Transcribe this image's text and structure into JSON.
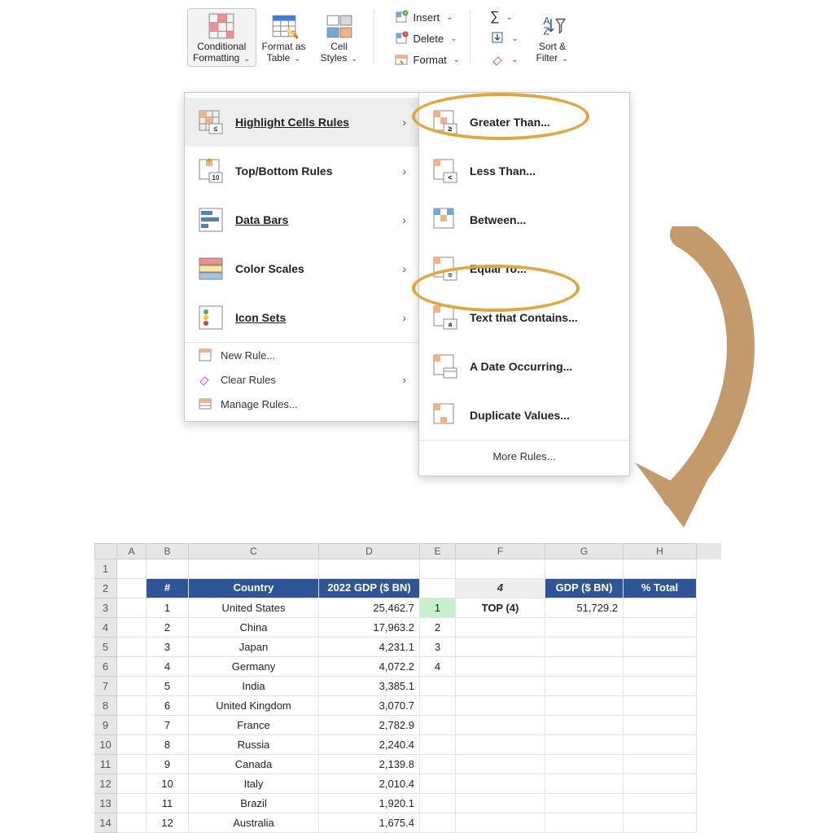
{
  "ribbon": {
    "cond": {
      "l1": "Conditional",
      "l2": "Formatting"
    },
    "fmtTable": {
      "l1": "Format as",
      "l2": "Table"
    },
    "cellStyles": {
      "l1": "Cell",
      "l2": "Styles"
    },
    "insert": "Insert",
    "delete": "Delete",
    "format": "Format",
    "sortFilter": {
      "l1": "Sort &",
      "l2": "Filter"
    }
  },
  "menu1": {
    "items": [
      {
        "label": "Highlight Cells Rules"
      },
      {
        "label": "Top/Bottom Rules"
      },
      {
        "label": "Data Bars"
      },
      {
        "label": "Color Scales"
      },
      {
        "label": "Icon Sets"
      }
    ],
    "sub": [
      {
        "label": "New Rule..."
      },
      {
        "label": "Clear Rules"
      },
      {
        "label": "Manage Rules..."
      }
    ]
  },
  "menu2": {
    "items": [
      {
        "label": "Greater Than..."
      },
      {
        "label": "Less Than..."
      },
      {
        "label": "Between..."
      },
      {
        "label": "Equal To..."
      },
      {
        "label": "Text that Contains..."
      },
      {
        "label": "A Date Occurring..."
      },
      {
        "label": "Duplicate Values..."
      }
    ],
    "more": "More Rules..."
  },
  "sheet": {
    "cols": [
      "",
      "A",
      "B",
      "C",
      "D",
      "E",
      "F",
      "G",
      "H"
    ],
    "header": {
      "num": "#",
      "country": "Country",
      "gdp": "2022 GDP ($ BN)",
      "fval": "4",
      "gbn": "GDP ($ BN)",
      "pct": "% Total"
    },
    "side": {
      "top": "TOP (4)",
      "gdpSum": "51,729.2"
    },
    "e": [
      "1",
      "2",
      "3",
      "4"
    ],
    "rows": [
      {
        "r": "1"
      },
      {
        "r": "2",
        "n": "#"
      },
      {
        "r": "3",
        "n": "1",
        "c": "United States",
        "g": "25,462.7"
      },
      {
        "r": "4",
        "n": "2",
        "c": "China",
        "g": "17,963.2"
      },
      {
        "r": "5",
        "n": "3",
        "c": "Japan",
        "g": "4,231.1"
      },
      {
        "r": "6",
        "n": "4",
        "c": "Germany",
        "g": "4,072.2"
      },
      {
        "r": "7",
        "n": "5",
        "c": "India",
        "g": "3,385.1"
      },
      {
        "r": "8",
        "n": "6",
        "c": "United Kingdom",
        "g": "3,070.7"
      },
      {
        "r": "9",
        "n": "7",
        "c": "France",
        "g": "2,782.9"
      },
      {
        "r": "10",
        "n": "8",
        "c": "Russia",
        "g": "2,240.4"
      },
      {
        "r": "11",
        "n": "9",
        "c": "Canada",
        "g": "2,139.8"
      },
      {
        "r": "12",
        "n": "10",
        "c": "Italy",
        "g": "2,010.4"
      },
      {
        "r": "13",
        "n": "11",
        "c": "Brazil",
        "g": "1,920.1"
      },
      {
        "r": "14",
        "n": "12",
        "c": "Australia",
        "g": "1,675.4"
      }
    ]
  }
}
